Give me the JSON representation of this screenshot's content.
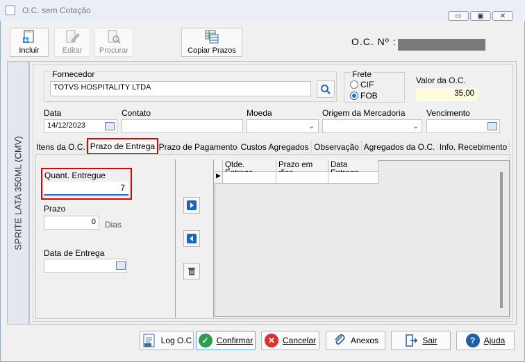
{
  "window": {
    "title": "O.C. sem Cotação"
  },
  "toolbar": {
    "incluir": "Incluir",
    "editar": "Editar",
    "procurar": "Procurar",
    "copiar_prazos": "Copiar Prazos"
  },
  "header": {
    "oc_label": "O.C. Nº :"
  },
  "side": {
    "product": "SPRITE LATA 350ML (CMV)"
  },
  "form": {
    "fornecedor_label": "Fornecedor",
    "fornecedor_value": "TOTVS HOSPITALITY LTDA",
    "frete_label": "Frete",
    "frete_options": [
      "CIF",
      "FOB"
    ],
    "frete_selected": "FOB",
    "valor_label": "Valor da O.C.",
    "valor_value": "35,00",
    "data_label": "Data",
    "data_value": "14/12/2023",
    "contato_label": "Contato",
    "moeda_label": "Moeda",
    "origem_label": "Origem da Mercadoria",
    "vencimento_label": "Vencimento"
  },
  "tabs": [
    "Itens da O.C.",
    "Prazo de Entrega",
    "Prazo de Pagamento",
    "Custos Agregados",
    "Observação",
    "Agregados da O.C.",
    "Info. Recebimento"
  ],
  "active_tab": "Prazo de Entrega",
  "prazo": {
    "quant_label": "Quant. Entregue",
    "quant_value": "7",
    "prazo_label": "Prazo",
    "prazo_value": "0",
    "dias": "Dias",
    "data_entrega_label": "Data de Entrega"
  },
  "grid": {
    "columns": [
      "Qtde. Entrega",
      "Prazo em dias",
      "Data Entrega"
    ]
  },
  "buttons": {
    "log": "Log O.C",
    "confirmar": "Confirmar",
    "cancelar": "Cancelar",
    "anexos": "Anexos",
    "sair": "Sair",
    "ajuda": "Ajuda"
  },
  "colors": {
    "highlight": "#e00000",
    "valor_bg": "#fffde0"
  }
}
